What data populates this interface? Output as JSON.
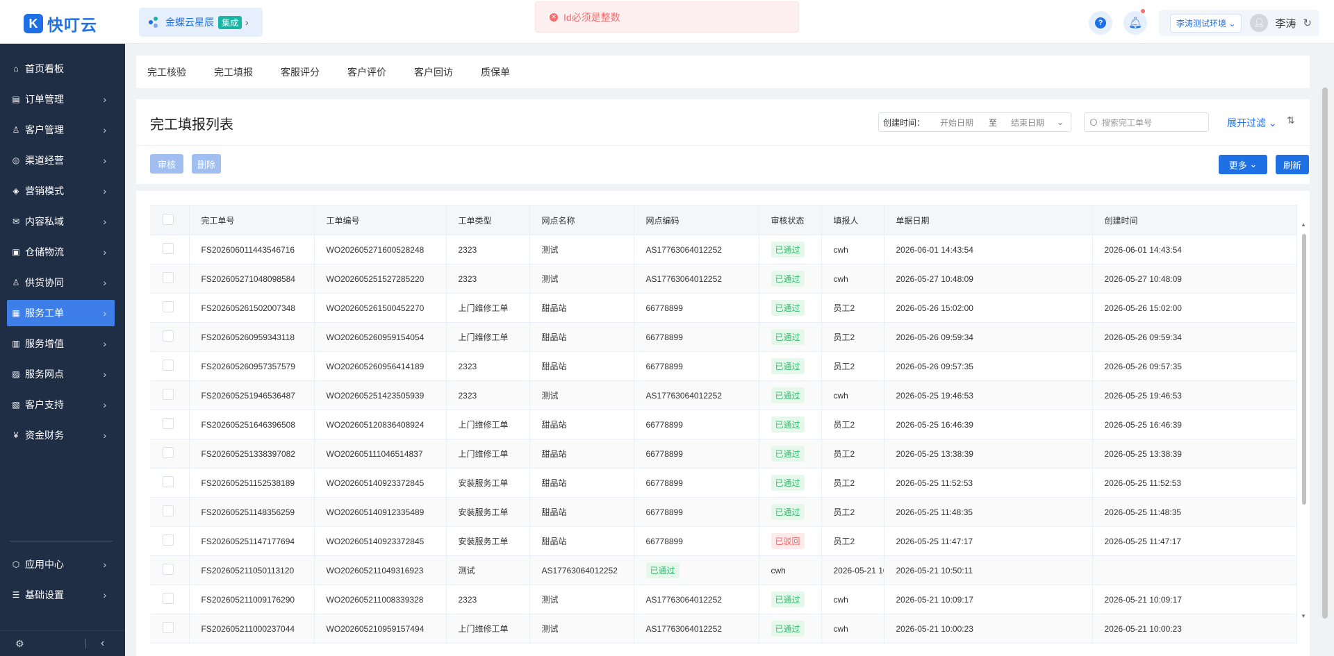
{
  "app": {
    "logo_char": "K",
    "name": "快叮云"
  },
  "brand": {
    "name": "金蝶云星辰",
    "tag": "集成"
  },
  "toast": {
    "message": "Id必须是整数"
  },
  "header": {
    "env": "李涛测试环境",
    "user": "李涛"
  },
  "sidebar": {
    "items": [
      {
        "label": "首页看板",
        "icon": "⌂"
      },
      {
        "label": "订单管理",
        "icon": "▤"
      },
      {
        "label": "客户管理",
        "icon": "♙"
      },
      {
        "label": "渠道经营",
        "icon": "◎"
      },
      {
        "label": "营销模式",
        "icon": "◈"
      },
      {
        "label": "内容私域",
        "icon": "✉"
      },
      {
        "label": "仓储物流",
        "icon": "▣"
      },
      {
        "label": "供货协同",
        "icon": "♙"
      },
      {
        "label": "服务工单",
        "icon": "▦"
      },
      {
        "label": "服务增值",
        "icon": "▥"
      },
      {
        "label": "服务网点",
        "icon": "▨"
      },
      {
        "label": "客户支持",
        "icon": "▧"
      },
      {
        "label": "资金财务",
        "icon": "¥"
      }
    ],
    "bottom_items": [
      {
        "label": "应用中心",
        "icon": "⬡"
      },
      {
        "label": "基础设置",
        "icon": "☰"
      }
    ]
  },
  "tabs": [
    "完工核验",
    "完工填报",
    "客服评分",
    "客户评价",
    "客户回访",
    "质保单"
  ],
  "page": {
    "title": "完工填报列表",
    "created_label": "创建时间：",
    "start_placeholder": "开始日期",
    "range_sep": "至",
    "end_placeholder": "结束日期",
    "search_placeholder": "搜索完工单号",
    "expand_filter": "展开过滤",
    "audit_btn": "审核",
    "delete_btn": "删除",
    "more_btn": "更多",
    "refresh_btn": "刷新"
  },
  "table": {
    "columns": [
      "完工单号",
      "工单编号",
      "工单类型",
      "网点名称",
      "网点编码",
      "审核状态",
      "填报人",
      "单据日期",
      "创建时间"
    ],
    "rows": [
      [
        "FS202606011443546716",
        "WO202605271600528248",
        "2323",
        "测试",
        "AS17763064012252",
        "已通过",
        "cwh",
        "2026-06-01 14:43:54",
        "2026-06-01 14:43:54"
      ],
      [
        "FS202605271048098584",
        "WO202605251527285220",
        "2323",
        "测试",
        "AS17763064012252",
        "已通过",
        "cwh",
        "2026-05-27 10:48:09",
        "2026-05-27 10:48:09"
      ],
      [
        "FS202605261502007348",
        "WO202605261500452270",
        "上门维修工单",
        "甜品站",
        "66778899",
        "已通过",
        "员工2",
        "2026-05-26 15:02:00",
        "2026-05-26 15:02:00"
      ],
      [
        "FS202605260959343118",
        "WO202605260959154054",
        "上门维修工单",
        "甜品站",
        "66778899",
        "已通过",
        "员工2",
        "2026-05-26 09:59:34",
        "2026-05-26 09:59:34"
      ],
      [
        "FS202605260957357579",
        "WO202605260956414189",
        "2323",
        "甜品站",
        "66778899",
        "已通过",
        "员工2",
        "2026-05-26 09:57:35",
        "2026-05-26 09:57:35"
      ],
      [
        "FS202605251946536487",
        "WO202605251423505939",
        "2323",
        "测试",
        "AS17763064012252",
        "已通过",
        "cwh",
        "2026-05-25 19:46:53",
        "2026-05-25 19:46:53"
      ],
      [
        "FS202605251646396508",
        "WO202605120836408924",
        "上门维修工单",
        "甜品站",
        "66778899",
        "已通过",
        "员工2",
        "2026-05-25 16:46:39",
        "2026-05-25 16:46:39"
      ],
      [
        "FS202605251338397082",
        "WO202605111046514837",
        "上门维修工单",
        "甜品站",
        "66778899",
        "已通过",
        "员工2",
        "2026-05-25 13:38:39",
        "2026-05-25 13:38:39"
      ],
      [
        "FS202605251152538189",
        "WO202605140923372845",
        "安装服务工单",
        "甜品站",
        "66778899",
        "已通过",
        "员工2",
        "2026-05-25 11:52:53",
        "2026-05-25 11:52:53"
      ],
      [
        "FS202605251148356259",
        "WO202605140912335489",
        "安装服务工单",
        "甜品站",
        "66778899",
        "已通过",
        "员工2",
        "2026-05-25 11:48:35",
        "2026-05-25 11:48:35"
      ],
      [
        "FS202605251147177694",
        "WO202605140923372845",
        "安装服务工单",
        "甜品站",
        "66778899",
        "已驳回",
        "员工2",
        "2026-05-25 11:47:17",
        "2026-05-25 11:47:17"
      ],
      [
        "FS202605211050113120",
        "WO202605211049316923",
        "测试",
        "AS17763064012252",
        "已通过",
        "cwh",
        "2026-05-21 10:50:11",
        "2026-05-21 10:50:11"
      ],
      [
        "FS202605211009176290",
        "WO202605211008339328",
        "2323",
        "测试",
        "AS17763064012252",
        "已通过",
        "cwh",
        "2026-05-21 10:09:17",
        "2026-05-21 10:09:17"
      ],
      [
        "FS202605211000237044",
        "WO202605210959157494",
        "上门维修工单",
        "测试",
        "AS17763064012252",
        "已通过",
        "cwh",
        "2026-05-21 10:00:23",
        "2026-05-21 10:00:23"
      ]
    ]
  },
  "colors": {
    "primary": "#1f6fe5",
    "sidebar_bg": "#1f2d45",
    "ok": "#3bb46e",
    "reject": "#f06262"
  }
}
